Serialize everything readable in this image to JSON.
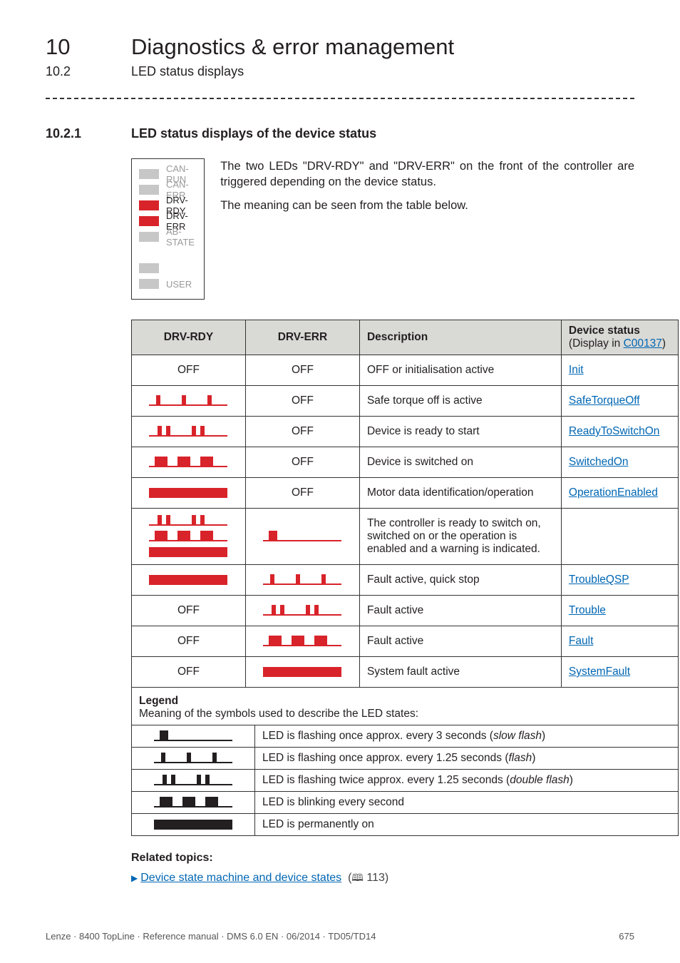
{
  "chapter": {
    "num": "10",
    "title": "Diagnostics & error management"
  },
  "subsection": {
    "num": "10.2",
    "title": "LED status displays"
  },
  "section": {
    "num": "10.2.1",
    "title": "LED status displays of the device status"
  },
  "diagram": {
    "items": [
      {
        "label": "CAN-RUN",
        "color": "grey",
        "active": false
      },
      {
        "label": "CAN-ERR",
        "color": "grey",
        "active": false
      },
      {
        "label": "DRV-RDY",
        "color": "red",
        "active": true
      },
      {
        "label": "DRV-ERR",
        "color": "red",
        "active": true
      },
      {
        "label": "AB-STATE",
        "color": "grey",
        "active": false
      },
      {
        "label": "",
        "color": "blank",
        "active": false
      },
      {
        "label": "",
        "color": "grey",
        "active": false
      },
      {
        "label": "USER",
        "color": "grey",
        "active": false
      }
    ]
  },
  "intro": {
    "p1": "The two LEDs \"DRV-RDY\" and \"DRV-ERR\" on the front of the controller are triggered depending on the device status.",
    "p2": "The meaning can be seen from the table below."
  },
  "table": {
    "headers": {
      "col1": "DRV-RDY",
      "col2": "DRV-ERR",
      "col3": "Description",
      "col4a": "Device status",
      "col4b_prefix": "(Display in ",
      "col4b_link": "C00137",
      "col4b_suffix": ")"
    },
    "rows": [
      {
        "rdy": "off_text",
        "err": "off_text",
        "desc": "OFF or initialisation active",
        "state": "Init"
      },
      {
        "rdy": "flash",
        "err": "off_text",
        "desc": "Safe torque off is active",
        "state": "SafeTorqueOff"
      },
      {
        "rdy": "double_flash",
        "err": "off_text",
        "desc": "Device is ready to start",
        "state": "ReadyToSwitchOn"
      },
      {
        "rdy": "blink",
        "err": "off_text",
        "desc": "Device is switched on",
        "state": "SwitchedOn"
      },
      {
        "rdy": "on",
        "err": "off_text",
        "desc": "Motor data identification/operation",
        "state": "OperationEnabled"
      },
      {
        "rdy": "stack3",
        "err": "slow_flash",
        "desc": "The controller is ready to switch on, switched on or the operation is enabled and a warning is indicated.",
        "state": ""
      },
      {
        "rdy": "on",
        "err": "flash",
        "desc": "Fault active, quick stop",
        "state": "TroubleQSP"
      },
      {
        "rdy": "off_text",
        "err": "double_flash",
        "desc": "Fault active",
        "state": "Trouble"
      },
      {
        "rdy": "off_text",
        "err": "blink",
        "desc": "Fault active",
        "state": "Fault"
      },
      {
        "rdy": "off_text",
        "err": "on",
        "desc": "System fault active",
        "state": "SystemFault"
      }
    ]
  },
  "off_label": "OFF",
  "legend": {
    "title": "Legend",
    "subtitle": "Meaning of the symbols used to describe the LED states:",
    "rows": [
      {
        "sym": "slow_flash",
        "text_pre": "LED is flashing once approx. every 3 seconds (",
        "text_ital": "slow flash",
        "text_post": ")"
      },
      {
        "sym": "flash",
        "text_pre": "LED is flashing once approx. every 1.25 seconds (",
        "text_ital": "flash",
        "text_post": ")"
      },
      {
        "sym": "double_flash",
        "text_pre": "LED is flashing twice approx. every 1.25 seconds (",
        "text_ital": "double flash",
        "text_post": ")"
      },
      {
        "sym": "blink",
        "text_pre": "LED is blinking every second",
        "text_ital": "",
        "text_post": ""
      },
      {
        "sym": "on",
        "text_pre": "LED is permanently on",
        "text_ital": "",
        "text_post": ""
      }
    ]
  },
  "related": {
    "hdr": "Related topics:",
    "link_text": "Device state machine and device states",
    "page_ref": "113"
  },
  "footer": {
    "left": "Lenze · 8400 TopLine · Reference manual · DMS 6.0 EN · 06/2014 · TD05/TD14",
    "right": "675"
  }
}
